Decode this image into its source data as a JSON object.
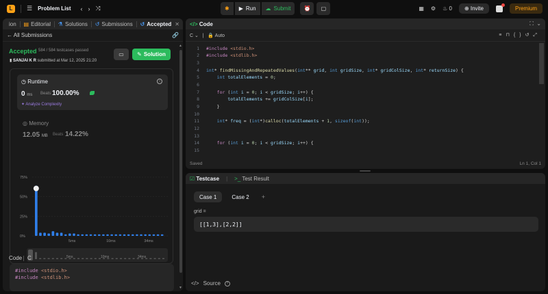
{
  "topbar": {
    "title": "Problem List",
    "run_label": "Run",
    "submit_label": "Submit",
    "streak_count": "0",
    "invite_label": "Invite",
    "premium_label": "Premium"
  },
  "tabs": [
    {
      "label": "ion"
    },
    {
      "label": "Editorial"
    },
    {
      "label": "Solutions"
    },
    {
      "label": "Submissions"
    },
    {
      "label": "Accepted"
    }
  ],
  "submission": {
    "back_label": "All Submissions",
    "status": "Accepted",
    "passed": "584 / 584 testcases passed",
    "user": "SANJAI K R",
    "submitted_text": "submitted at Mar 12, 2025 21:20",
    "solution_label": "Solution"
  },
  "runtime": {
    "title": "Runtime",
    "value": "0",
    "unit": "ms",
    "beats_label": "Beats",
    "beats_pct": "100.00%",
    "analyze_label": "Analyze Complexity"
  },
  "memory": {
    "title": "Memory",
    "value": "12.05",
    "unit": "MB",
    "beats_label": "Beats",
    "beats_pct": "14.22%"
  },
  "chart_data": {
    "type": "bar",
    "y_ticks": [
      "75%",
      "50%",
      "25%",
      "0%"
    ],
    "ylim": [
      0,
      75
    ],
    "x_ticks": [
      {
        "label": "5ms",
        "index": 8
      },
      {
        "label": "10ms",
        "index": 17
      },
      {
        "label": "34ms",
        "index": 26
      }
    ],
    "values": [
      64,
      4,
      4,
      3,
      6,
      4,
      4,
      2,
      3,
      3,
      2,
      2,
      2,
      2,
      2,
      2,
      2,
      2,
      2,
      2,
      2,
      2,
      2,
      2,
      2,
      2,
      2,
      2,
      2,
      2,
      2
    ],
    "highlight_index": 0,
    "mini_ticks": [
      "5ms",
      "10ms",
      "34ms"
    ]
  },
  "code_section": {
    "label": "Code",
    "lang": "C",
    "lines": [
      "#include <stdio.h>",
      "#include <stdlib.h>"
    ]
  },
  "editor": {
    "title": "Code",
    "lang": "C",
    "mode": "Auto",
    "status_left": "Saved",
    "status_right": "Ln 1, Col 1"
  },
  "testpanel": {
    "tab_testcase": "Testcase",
    "tab_result": "Test Result",
    "case1": "Case 1",
    "case2": "Case 2",
    "grid_label": "grid =",
    "grid_value": "[[1,3],[2,2]]",
    "source_label": "Source"
  },
  "colors": {
    "accent_green": "#2cbb5d",
    "brand_orange": "#ffa116",
    "bar_blue": "#2f7ee8"
  }
}
